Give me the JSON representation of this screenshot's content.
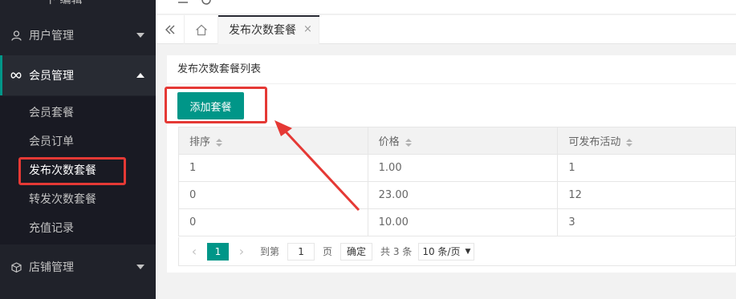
{
  "sidebar": {
    "partial_top": "下 编辑",
    "groups": [
      {
        "label": "用户管理",
        "icon": "user-icon"
      },
      {
        "label": "会员管理",
        "icon": "infinity-icon"
      },
      {
        "label": "店铺管理",
        "icon": "cube-icon"
      }
    ],
    "member_items": [
      {
        "label": "会员套餐"
      },
      {
        "label": "会员订单"
      },
      {
        "label": "发布次数套餐"
      },
      {
        "label": "转发次数套餐"
      },
      {
        "label": "充值记录"
      }
    ]
  },
  "tabs": {
    "active_label": "发布次数套餐",
    "close_glyph": "×"
  },
  "card": {
    "title": "发布次数套餐列表",
    "add_button": "添加套餐"
  },
  "table": {
    "headers": [
      "排序",
      "价格",
      "可发布活动"
    ],
    "rows": [
      [
        "1",
        "1.00",
        "1"
      ],
      [
        "0",
        "23.00",
        "12"
      ],
      [
        "0",
        "10.00",
        "3"
      ]
    ]
  },
  "pager": {
    "current_page": "1",
    "goto_label": "到第",
    "input_value": "1",
    "page_suffix": "页",
    "confirm": "确定",
    "total": "共 3 条",
    "page_size": "10 条/页"
  },
  "colors": {
    "sidebar_bg": "#20222a",
    "accent": "#009688",
    "highlight": "#e53935"
  }
}
